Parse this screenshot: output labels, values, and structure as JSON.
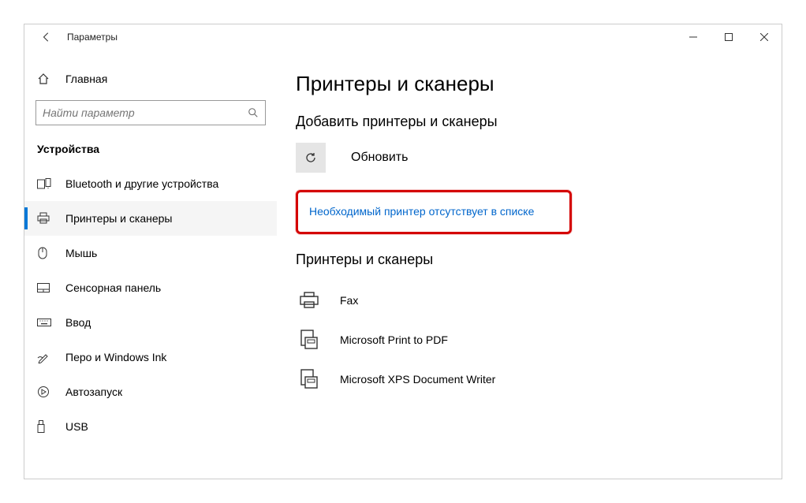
{
  "titlebar": {
    "title": "Параметры"
  },
  "sidebar": {
    "home": "Главная",
    "search_placeholder": "Найти параметр",
    "section": "Устройства",
    "items": [
      {
        "label": "Bluetooth и другие устройства"
      },
      {
        "label": "Принтеры и сканеры"
      },
      {
        "label": "Мышь"
      },
      {
        "label": "Сенсорная панель"
      },
      {
        "label": "Ввод"
      },
      {
        "label": "Перо и Windows Ink"
      },
      {
        "label": "Автозапуск"
      },
      {
        "label": "USB"
      }
    ]
  },
  "main": {
    "heading": "Принтеры и сканеры",
    "add_heading": "Добавить принтеры и сканеры",
    "refresh": "Обновить",
    "missing_link": "Необходимый принтер отсутствует в списке",
    "list_heading": "Принтеры и сканеры",
    "printers": [
      {
        "label": "Fax"
      },
      {
        "label": "Microsoft Print to PDF"
      },
      {
        "label": "Microsoft XPS Document Writer"
      }
    ]
  }
}
